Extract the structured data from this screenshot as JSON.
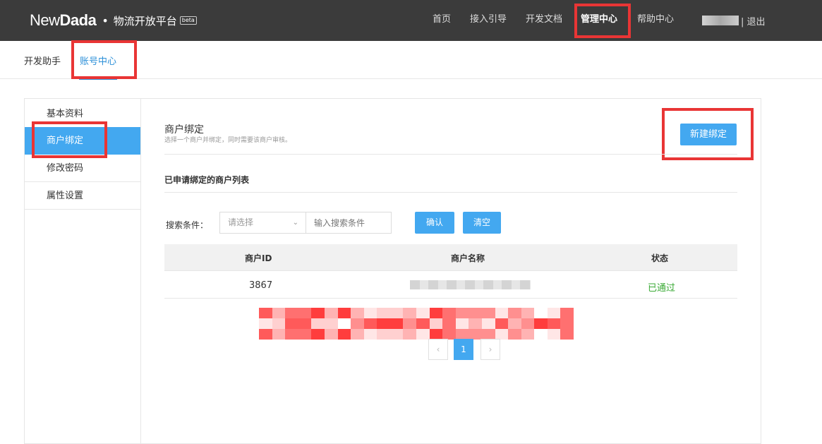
{
  "header": {
    "logo_new": "New",
    "logo_dada": "Dada",
    "logo_dot": "•",
    "logo_subtitle": "物流开放平台",
    "logo_badge": "beta",
    "nav": [
      {
        "label": "首页"
      },
      {
        "label": "接入引导"
      },
      {
        "label": "开发文档"
      },
      {
        "label": "管理中心"
      },
      {
        "label": "帮助中心"
      }
    ],
    "logout": "| 退出"
  },
  "subnav": {
    "items": [
      {
        "label": "开发助手"
      },
      {
        "label": "账号中心"
      }
    ]
  },
  "sidebar": {
    "items": [
      {
        "label": "基本资料"
      },
      {
        "label": "商户绑定"
      },
      {
        "label": "修改密码"
      },
      {
        "label": "属性设置"
      }
    ]
  },
  "main": {
    "title": "商户绑定",
    "subtitle": "选择一个商户并绑定，同时需要该商户审核。",
    "new_button": "新建绑定",
    "list_title": "已申请绑定的商户列表",
    "search": {
      "label": "搜索条件：",
      "select_value": "请选择",
      "input_placeholder": "输入搜索条件",
      "confirm_label": "确认",
      "clear_label": "清空"
    },
    "table": {
      "headers": [
        "商户ID",
        "商户名称",
        "状态"
      ],
      "rows": [
        {
          "id": "3867",
          "status": "已通过"
        }
      ]
    },
    "pagination": {
      "prev": "‹",
      "current": "1",
      "next": "›"
    }
  },
  "colors": {
    "topbar": "#3b3b3b",
    "accent": "#43a8f0",
    "highlight": "#e93535",
    "success": "#3aaa35"
  }
}
